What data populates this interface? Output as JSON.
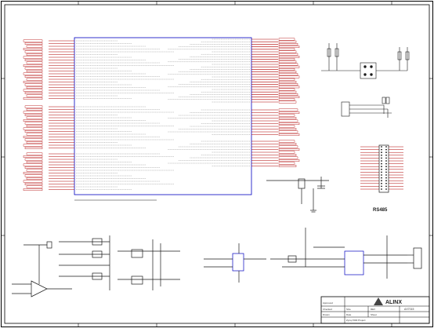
{
  "sheet_label": "RS485",
  "title_block": {
    "company": "ALINX",
    "col1": [
      "Approved",
      "Checked",
      "Drawn"
    ],
    "part_number": "AX7015",
    "rev_label": "REV",
    "sheet_label": "Sheet",
    "size_label": "Size",
    "date_label": "Date",
    "project": "Zynq-7000 Project"
  },
  "colors": {
    "wire": "#b00000",
    "line": "#1a1a1a",
    "component": "#1a1a1a",
    "chip_outline": "#0000c0",
    "frame": "#000000",
    "net_label": "#b00000"
  },
  "icons": {
    "logo": "alinx-triangle-logo",
    "ground": "ground-icon",
    "connector": "connector-icon"
  }
}
